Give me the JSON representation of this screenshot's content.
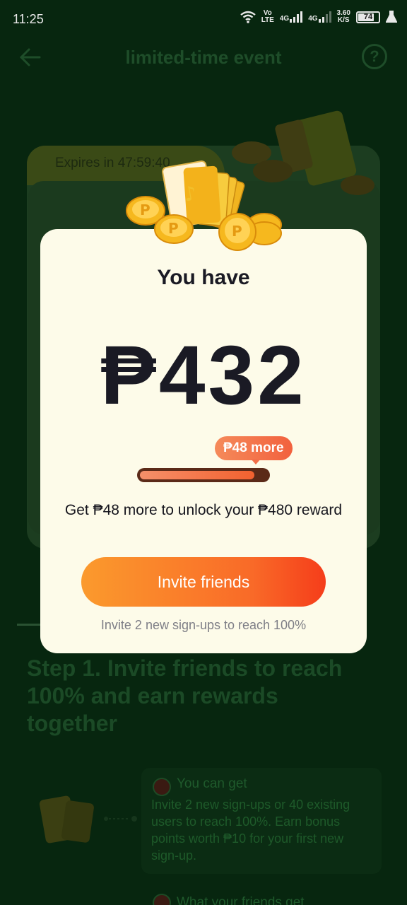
{
  "status_bar": {
    "time": "11:25",
    "volte_top": "Vo",
    "volte_bottom": "LTE",
    "net1": "4G",
    "net2": "4G",
    "speed_top": "3.60",
    "speed_bottom": "K/S",
    "battery": "74",
    "battery_level_percent": 74
  },
  "background_page": {
    "header_title": "limited-time event",
    "help_symbol": "?",
    "expires_text": "Expires in 47:59:40",
    "step_title": "Step 1. Invite friends to reach 100% and earn rewards together",
    "you_can_get_label": "You can get",
    "you_can_get_desc": "Invite 2 new sign-ups or 40 existing users to reach 100%. Earn bonus points worth ₱10 for your first new sign-up.",
    "friends_get_label": "What your friends get"
  },
  "modal": {
    "title": "You have",
    "amount": "₱432",
    "badge": "₱48 more",
    "progress_percent": 90,
    "unlock_text": "Get ₱48 more to unlock your ₱480 reward",
    "invite_button": "Invite friends",
    "invite_hint": "Invite 2 new sign-ups to reach 100%"
  },
  "colors": {
    "background": "#07260f",
    "modal": "#fdfbe9",
    "accent_orange": "#f96a28",
    "text_dark": "#1a1a24"
  }
}
